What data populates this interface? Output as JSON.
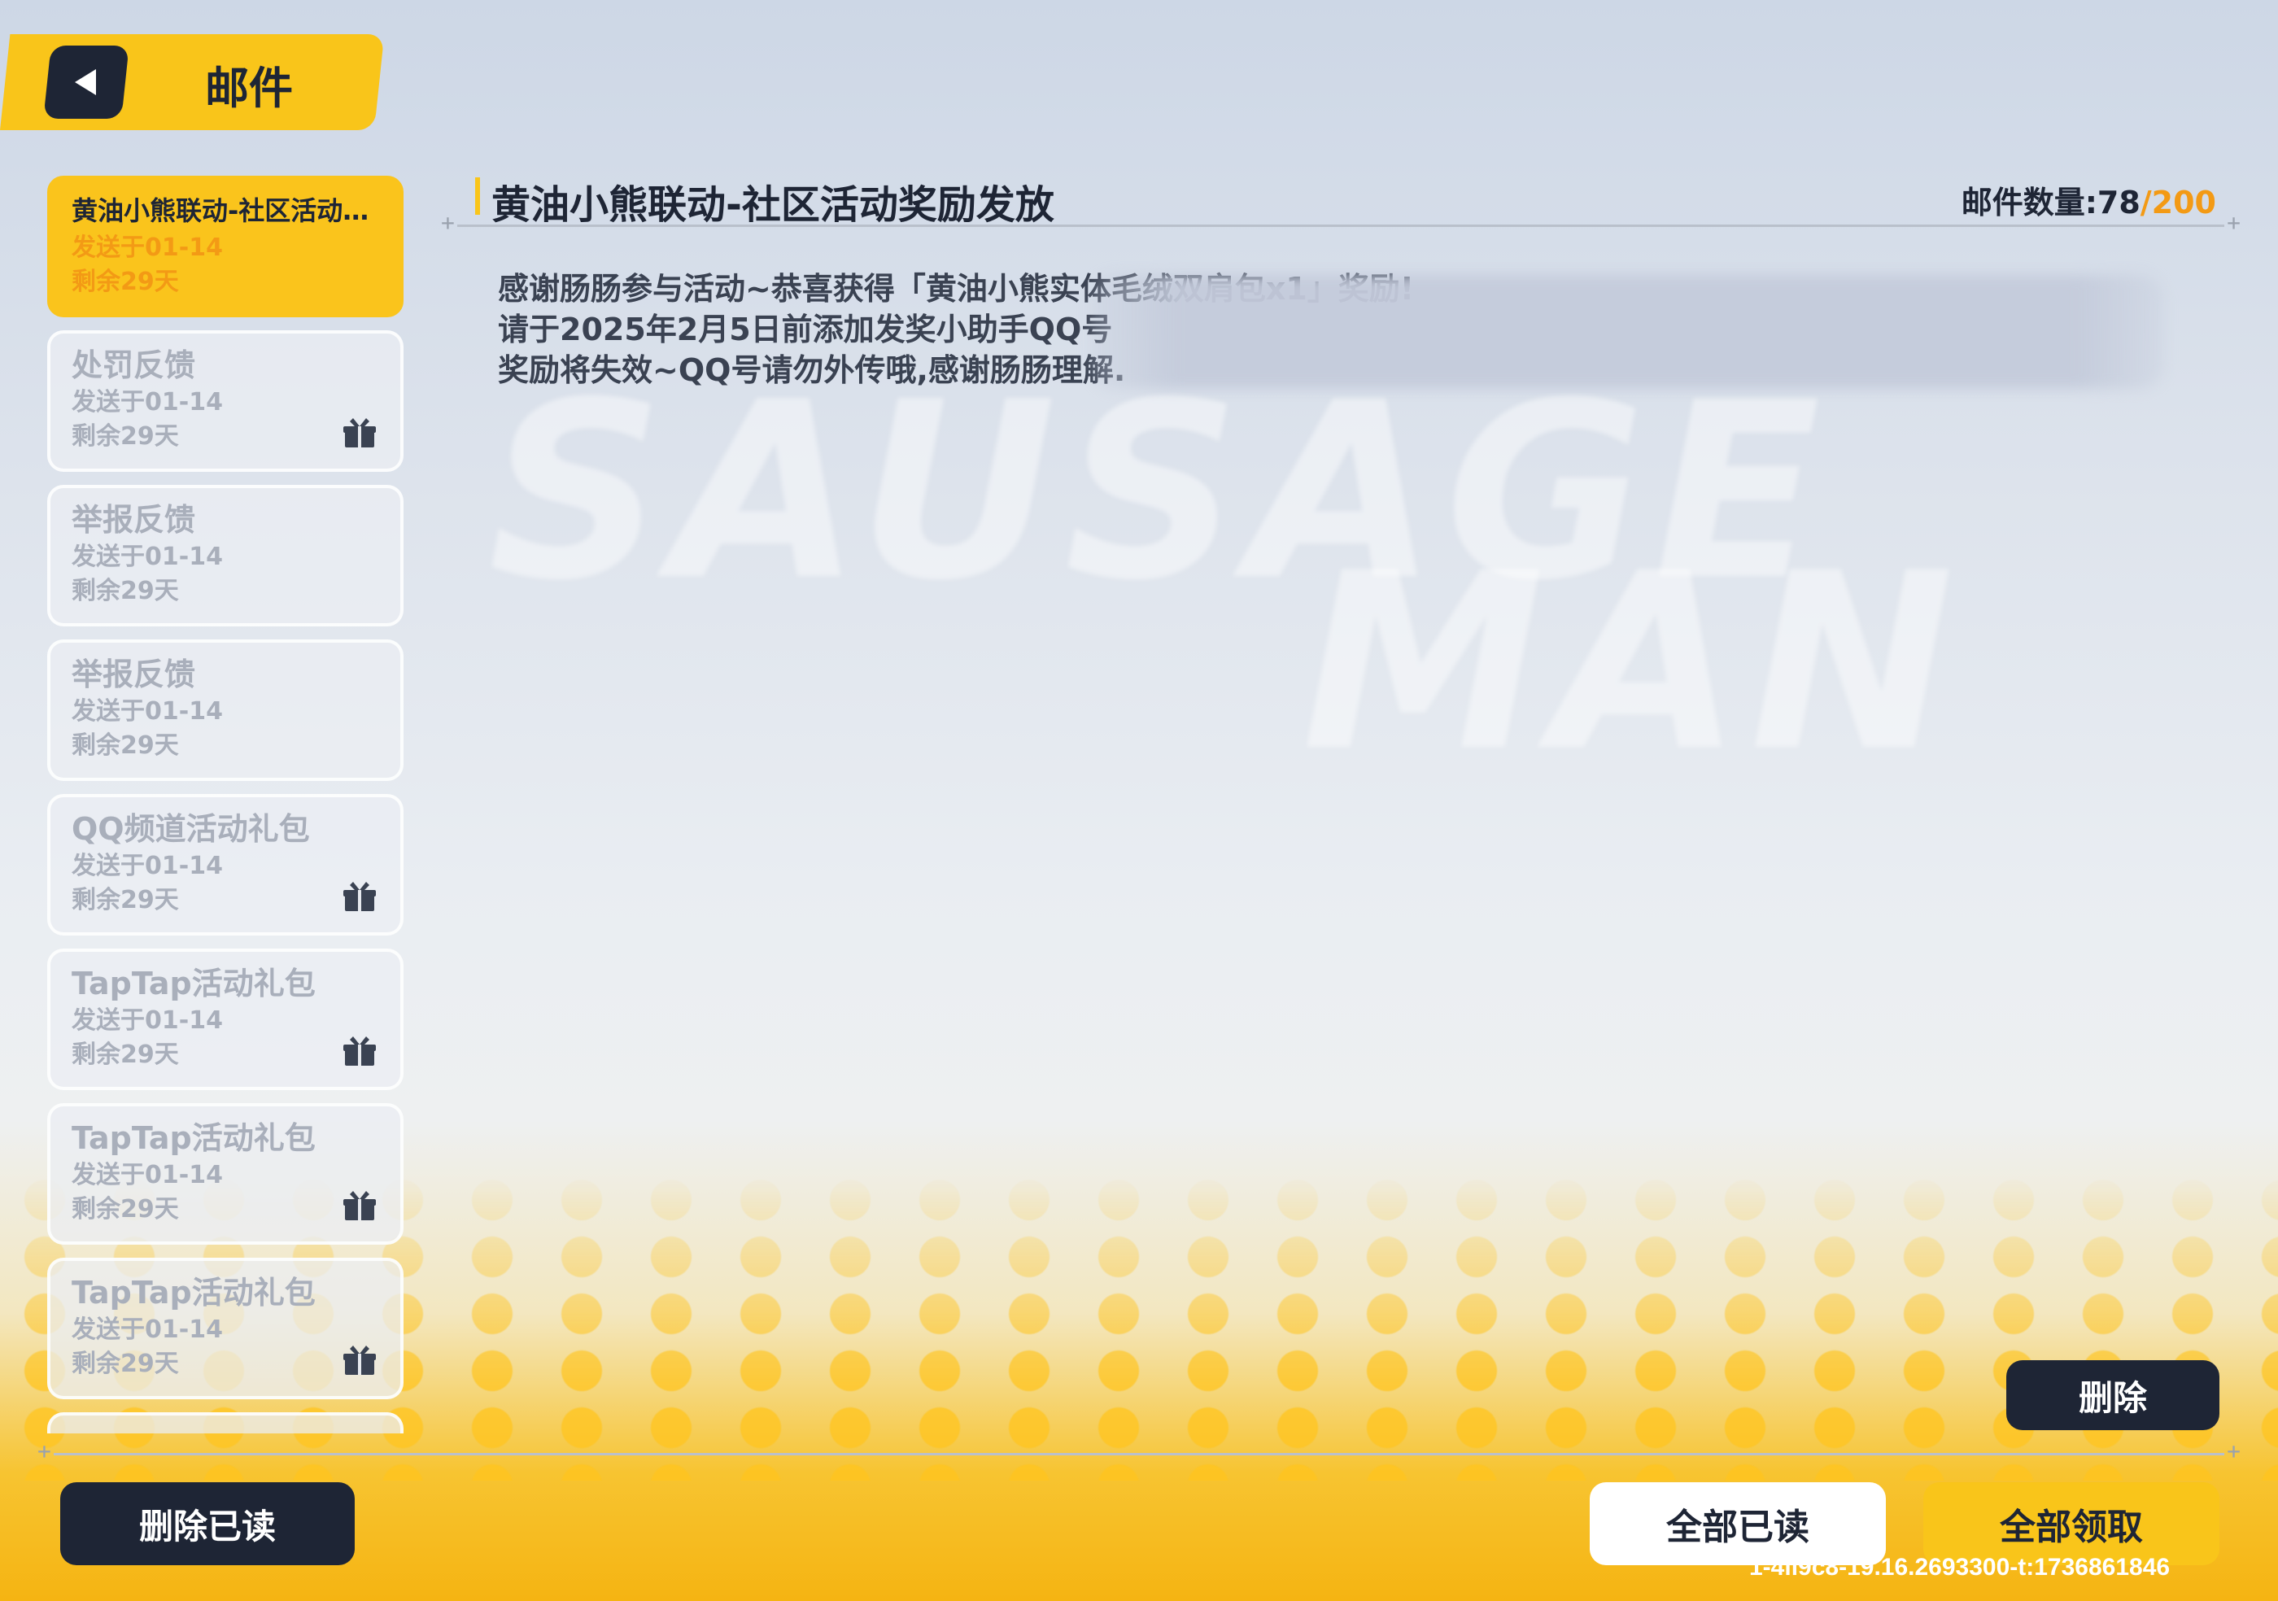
{
  "header": {
    "title": "邮件",
    "back_icon": "back-arrow-icon"
  },
  "mail_list": [
    {
      "title": "黄油小熊联动-社区活动奖励发放",
      "sent": "发送于01-14",
      "remaining": "剩余29天",
      "selected": true,
      "gift": false
    },
    {
      "title": "处罚反馈",
      "sent": "发送于01-14",
      "remaining": "剩余29天",
      "selected": false,
      "gift": true
    },
    {
      "title": "举报反馈",
      "sent": "发送于01-14",
      "remaining": "剩余29天",
      "selected": false,
      "gift": false
    },
    {
      "title": "举报反馈",
      "sent": "发送于01-14",
      "remaining": "剩余29天",
      "selected": false,
      "gift": false
    },
    {
      "title": "QQ频道活动礼包",
      "sent": "发送于01-14",
      "remaining": "剩余29天",
      "selected": false,
      "gift": true
    },
    {
      "title": "TapTap活动礼包",
      "sent": "发送于01-14",
      "remaining": "剩余29天",
      "selected": false,
      "gift": true
    },
    {
      "title": "TapTap活动礼包",
      "sent": "发送于01-14",
      "remaining": "剩余29天",
      "selected": false,
      "gift": true
    },
    {
      "title": "TapTap活动礼包",
      "sent": "发送于01-14",
      "remaining": "剩余29天",
      "selected": false,
      "gift": true
    }
  ],
  "detail": {
    "title": "黄油小熊联动-社区活动奖励发放",
    "count_label": "邮件数量:",
    "count_current": "78",
    "count_max": "/200",
    "body": [
      "感谢肠肠参与活动~恭喜获得「黄油小熊实体毛绒双肩包x1」奖励!",
      "请于2025年2月5日前添加发奖小助手QQ号",
      "奖励将失效~QQ号请勿外传哦,感谢肠肠理解."
    ]
  },
  "buttons": {
    "delete": "删除",
    "delete_read": "删除已读",
    "read_all": "全部已读",
    "claim_all": "全部领取"
  },
  "watermark": "1-4ll9c8-19.16.2693300-t:1736861846",
  "colors": {
    "accent": "#f9c51a",
    "dark": "#1e2535",
    "orange": "#f39a15"
  }
}
